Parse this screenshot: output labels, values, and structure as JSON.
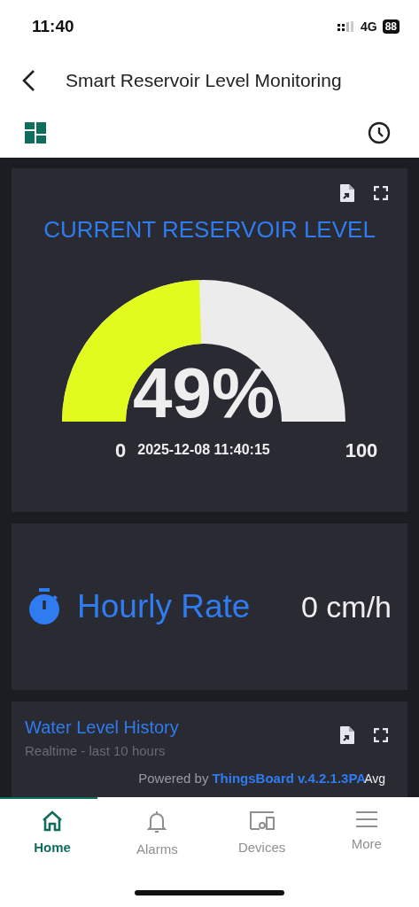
{
  "status_bar": {
    "time": "11:40",
    "network": "4G",
    "battery": "88"
  },
  "header": {
    "title": "Smart Reservoir Level Monitoring"
  },
  "gauge_card": {
    "title": "CURRENT RESERVOIR LEVEL",
    "value": "49%",
    "min": "0",
    "max": "100",
    "timestamp": "2025-12-08 11:40:15"
  },
  "rate_card": {
    "label": "Hourly Rate",
    "value": "0 cm/h"
  },
  "history_card": {
    "title": "Water Level History",
    "subtitle": "Realtime - last 10 hours",
    "powered_by": "Powered by",
    "brand": "ThingsBoard v.4.2.1.3PA",
    "legend": "Avg"
  },
  "nav": [
    {
      "label": "Home",
      "selected": true
    },
    {
      "label": "Alarms",
      "selected": false
    },
    {
      "label": "Devices",
      "selected": false
    },
    {
      "label": "More",
      "selected": false
    }
  ]
}
